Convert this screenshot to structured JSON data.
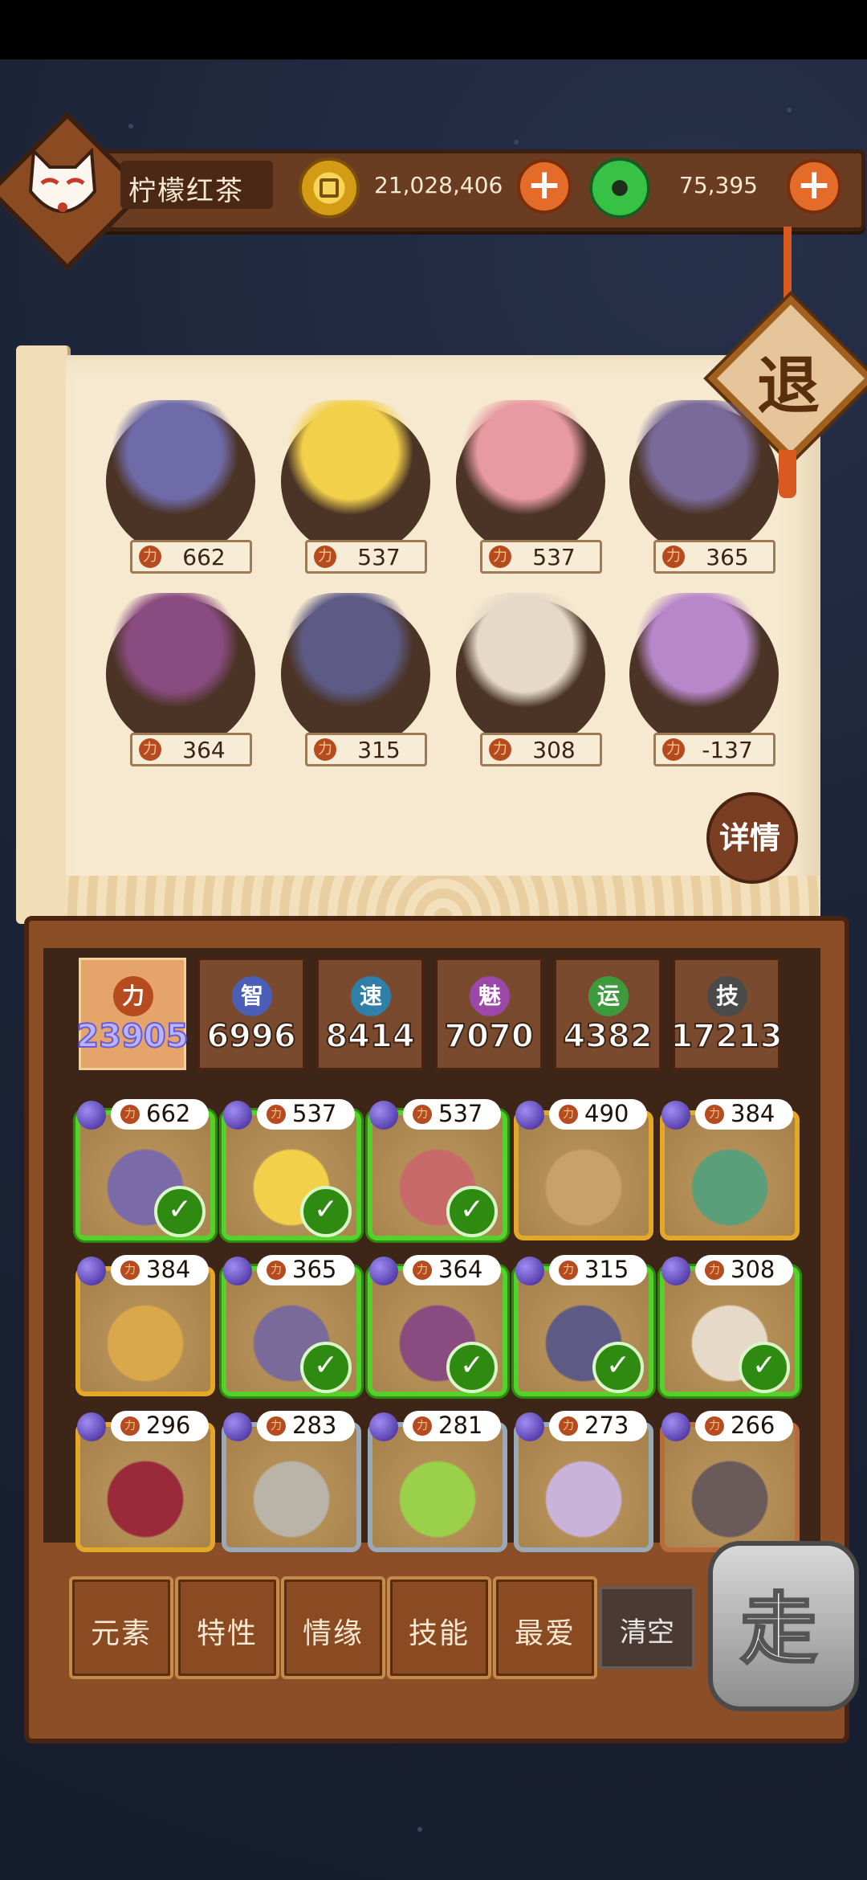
{
  "header": {
    "player_name": "柠檬红茶",
    "gold": "21,028,406",
    "jade": "75,395"
  },
  "exit_label": "退",
  "team": [
    {
      "power": "662",
      "color": "#6f6aa8"
    },
    {
      "power": "537",
      "color": "#f2d04a"
    },
    {
      "power": "537",
      "color": "#e79aa1"
    },
    {
      "power": "365",
      "color": "#7a6a9a"
    },
    {
      "power": "364",
      "color": "#8a4b80"
    },
    {
      "power": "315",
      "color": "#5d5b86"
    },
    {
      "power": "308",
      "color": "#e6d9c7"
    },
    {
      "power": "-137",
      "color": "#b787c9"
    }
  ],
  "detail_label": "详情",
  "stats": [
    {
      "icon": "力",
      "value": "23905",
      "color": "#b54b1f",
      "active": true
    },
    {
      "icon": "智",
      "value": "6996",
      "color": "#4b5fb8",
      "active": false
    },
    {
      "icon": "速",
      "value": "8414",
      "color": "#2f7fa8",
      "active": false
    },
    {
      "icon": "魅",
      "value": "7070",
      "color": "#9b48a8",
      "active": false
    },
    {
      "icon": "运",
      "value": "4382",
      "color": "#3d9b3e",
      "active": false
    },
    {
      "icon": "技",
      "value": "17213",
      "color": "#4a4a4a",
      "active": false
    }
  ],
  "roster": [
    {
      "power": "662",
      "selected": true,
      "frame": "gold",
      "color": "#7b6aa8"
    },
    {
      "power": "537",
      "selected": true,
      "frame": "gold",
      "color": "#f2d04a"
    },
    {
      "power": "537",
      "selected": true,
      "frame": "gold",
      "color": "#c86a6a"
    },
    {
      "power": "490",
      "selected": false,
      "frame": "gold",
      "color": "#caa06a"
    },
    {
      "power": "384",
      "selected": false,
      "frame": "gold",
      "color": "#5b9e7a"
    },
    {
      "power": "384",
      "selected": false,
      "frame": "gold",
      "color": "#d9a84a"
    },
    {
      "power": "365",
      "selected": true,
      "frame": "gold",
      "color": "#7a6a9a"
    },
    {
      "power": "364",
      "selected": true,
      "frame": "gold",
      "color": "#8a4b80"
    },
    {
      "power": "315",
      "selected": true,
      "frame": "gold",
      "color": "#5d5b86"
    },
    {
      "power": "308",
      "selected": true,
      "frame": "gold",
      "color": "#e6d9c7"
    },
    {
      "power": "296",
      "selected": false,
      "frame": "gold",
      "color": "#9a2a3a"
    },
    {
      "power": "283",
      "selected": false,
      "frame": "blue",
      "color": "#b9b3a8"
    },
    {
      "power": "281",
      "selected": false,
      "frame": "blue",
      "color": "#9ad04a"
    },
    {
      "power": "273",
      "selected": false,
      "frame": "blue",
      "color": "#c9b3d9"
    },
    {
      "power": "266",
      "selected": false,
      "frame": "copper",
      "color": "#6a5a5a"
    }
  ],
  "filters": [
    "元素",
    "特性",
    "情缘",
    "技能",
    "最爱"
  ],
  "clear_label": "清空",
  "go_label": "走"
}
